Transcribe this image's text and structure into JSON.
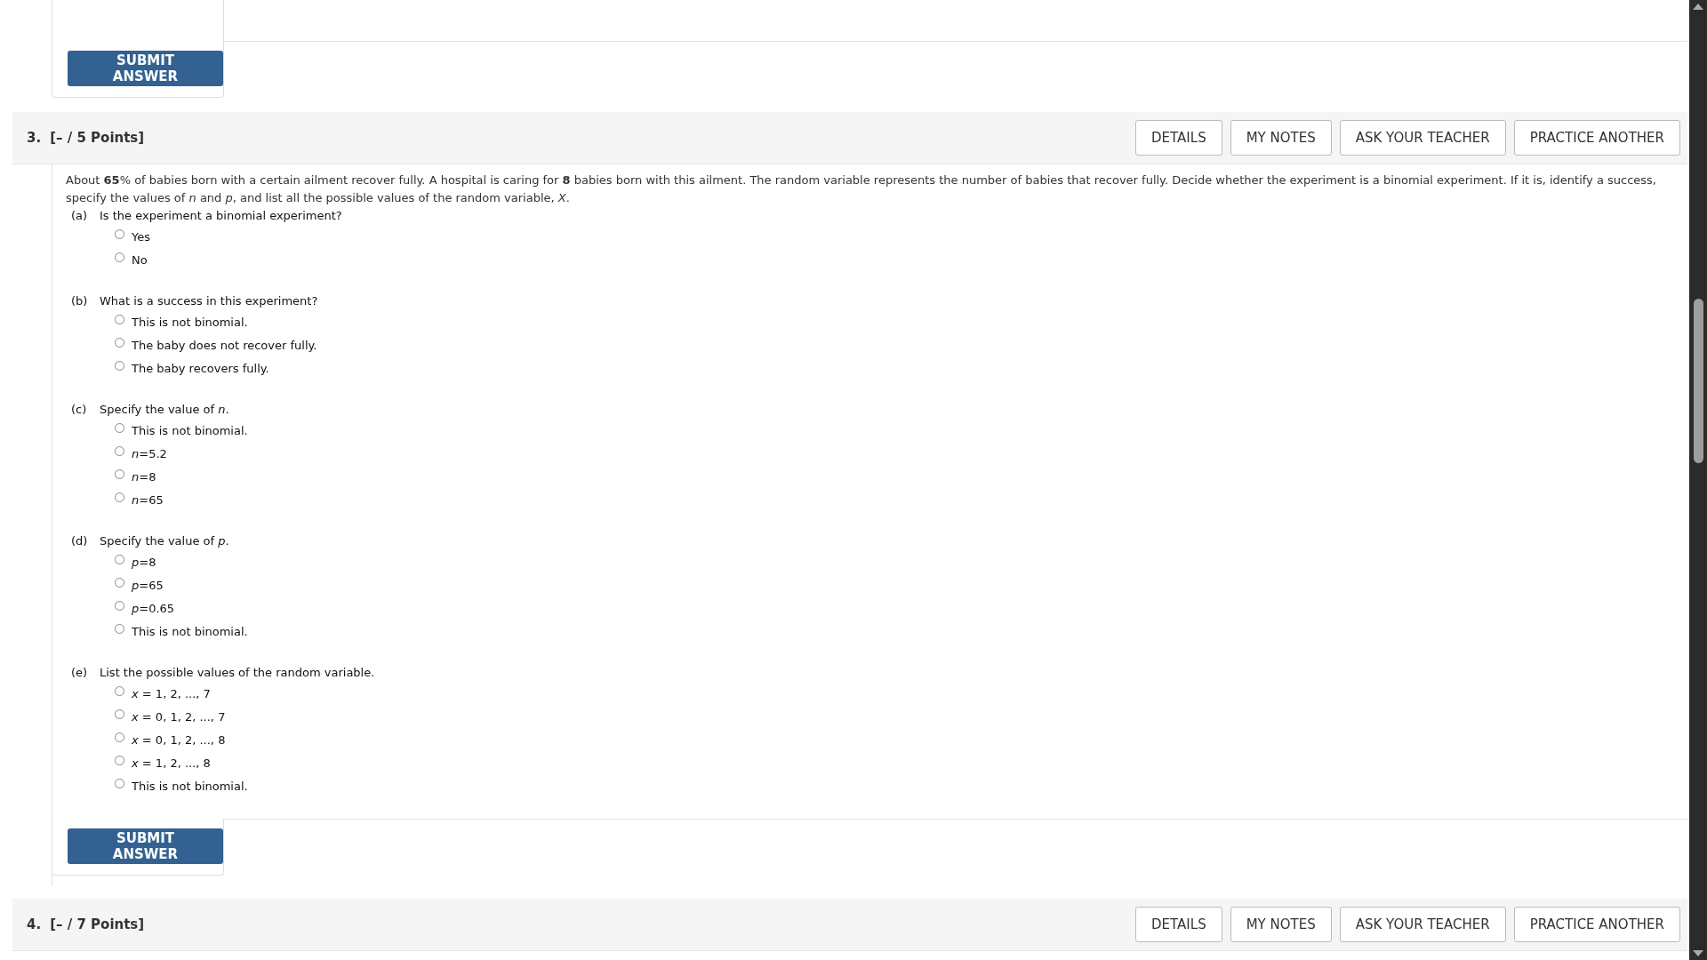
{
  "previous_question": {
    "submit_label": "SUBMIT ANSWER"
  },
  "questions": [
    {
      "number": "3.",
      "points": "[– / 5 Points]",
      "buttons": [
        "DETAILS",
        "MY NOTES",
        "ASK YOUR TEACHER",
        "PRACTICE ANOTHER"
      ],
      "text": "About **65**% of babies born with a certain ailment recover fully. A hospital is caring for **8** babies born with this ailment. The random variable represents the number of babies that recover fully. Decide whether the experiment is a binomial experiment. If it is, identify a success, specify the values of *n* and *p*, and list all the possible values of the random variable, *X*.",
      "parts": [
        {
          "label": "(a)",
          "prompt": "Is the experiment a binomial experiment?",
          "options": [
            {
              "text": "Yes",
              "selected": false
            },
            {
              "text": "No",
              "selected": false
            }
          ]
        },
        {
          "label": "(b)",
          "prompt": "What is a success in this experiment?",
          "options": [
            {
              "text": "This is not binomial.",
              "selected": false
            },
            {
              "text": "The baby does not recover fully.",
              "selected": false
            },
            {
              "text": "The baby recovers fully.",
              "selected": false
            }
          ]
        },
        {
          "label": "(c)",
          "prompt": "Specify the value of *n*.",
          "options": [
            {
              "text": "This is not binomial.",
              "selected": false
            },
            {
              "text": "*n*=5.2",
              "selected": false
            },
            {
              "text": "*n*=8",
              "selected": false
            },
            {
              "text": "*n*=65",
              "selected": false
            }
          ]
        },
        {
          "label": "(d)",
          "prompt": "Specify the value of *p*.",
          "options": [
            {
              "text": "*p*=8",
              "selected": false
            },
            {
              "text": "*p*=65",
              "selected": false
            },
            {
              "text": "*p*=0.65",
              "selected": false
            },
            {
              "text": "This is not binomial.",
              "selected": false
            }
          ]
        },
        {
          "label": "(e)",
          "prompt": "List the possible values of the random variable.",
          "options": [
            {
              "text": "*x* = 1, 2, ..., 7",
              "selected": false
            },
            {
              "text": "*x* = 0, 1, 2, ..., 7",
              "selected": false
            },
            {
              "text": "*x* = 0, 1, 2, ..., 8",
              "selected": false
            },
            {
              "text": "*x* = 1, 2, ..., 8",
              "selected": false
            },
            {
              "text": "This is not binomial.",
              "selected": false
            }
          ]
        }
      ],
      "submit_label": "SUBMIT ANSWER"
    },
    {
      "number": "4.",
      "points": "[– / 7 Points]",
      "buttons": [
        "DETAILS",
        "MY NOTES",
        "ASK YOUR TEACHER",
        "PRACTICE ANOTHER"
      ]
    }
  ]
}
